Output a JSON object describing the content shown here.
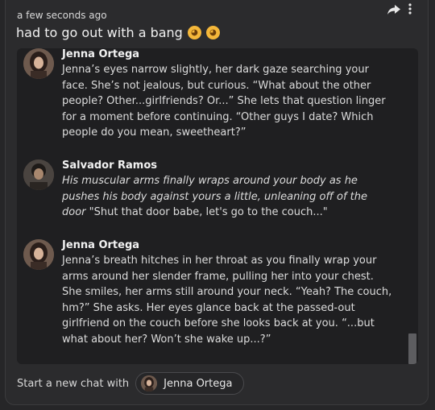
{
  "post": {
    "timestamp": "a few seconds ago",
    "title": "had to go out with a bang",
    "emojis": [
      "smirk-emoji",
      "smirk-emoji"
    ]
  },
  "messages": [
    {
      "name": "Jenna Ortega",
      "avatar": "jenna-avatar",
      "text": "Jenna’s eyes narrow slightly, her dark gaze searching your face. She’s not jealous, but curious. “What about the other people? Other...girlfriends? Or...” She lets that question linger for a moment before continuing. “Other guys I date? Which people do you mean, sweetheart?”"
    },
    {
      "name": "Salvador Ramos",
      "avatar": "salvador-avatar",
      "italic": "His muscular arms finally wraps around your body as he pushes his body against yours a little, unleaning off of the door",
      "text": " \"Shut that door babe, let's go to the couch...\""
    },
    {
      "name": "Jenna Ortega",
      "avatar": "jenna-avatar",
      "text": "Jenna’s breath hitches in her throat as you finally wrap your arms around her slender frame, pulling her into your chest. She smiles, her arms still around your neck. “Yeah? The couch, hm?” She asks. Her eyes glance back at the passed-out girlfriend on the couch before she looks back at you. “...but what about her? Won’t she wake up...?”"
    }
  ],
  "footer": {
    "start_label": "Start a new chat with",
    "chip_label": "Jenna Ortega"
  },
  "icons": {
    "share": "share-arrow-icon",
    "more": "more-vertical-icon"
  },
  "colors": {
    "background": "#262628",
    "card": "#2b2b2d",
    "embed": "#1f1f21",
    "emoji": "#f4b73a"
  }
}
